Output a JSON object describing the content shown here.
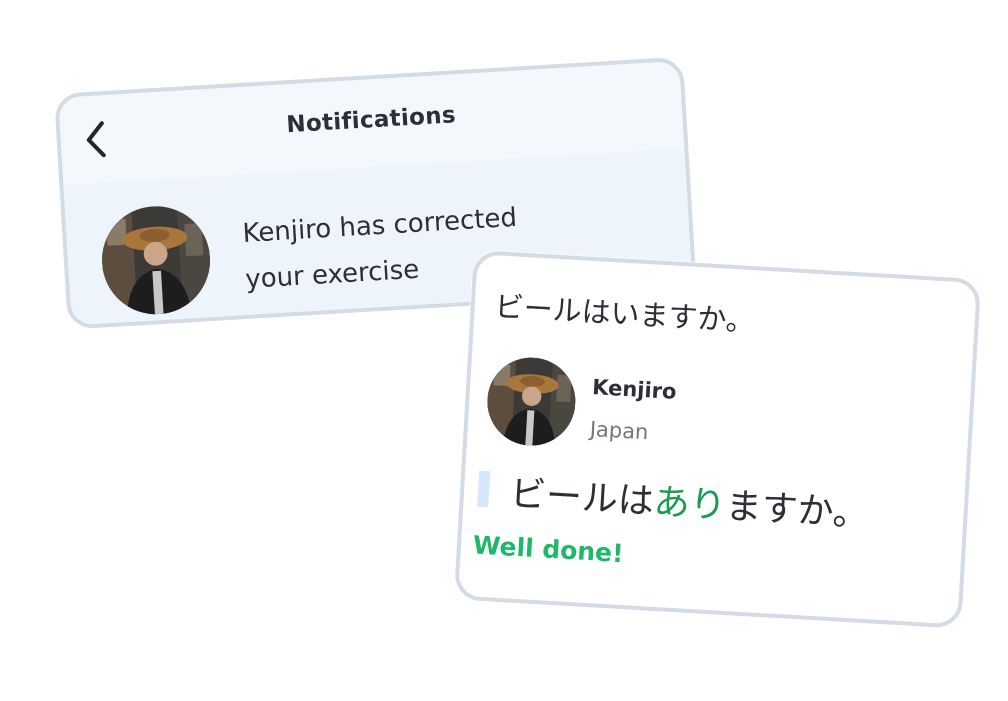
{
  "notification_card": {
    "title": "Notifications",
    "back_icon": "chevron-left-icon",
    "message_line1": "Kenjiro has corrected",
    "message_line2": "your exercise"
  },
  "correction_card": {
    "original_sentence": "ビールはいますか。",
    "user": {
      "name": "Kenjiro",
      "country": "Japan"
    },
    "corrected": {
      "prefix": "ビールは",
      "highlight": "あり",
      "suffix": "ますか。"
    },
    "feedback": "Well done!"
  },
  "colors": {
    "card_border": "#d3dce5",
    "correction_highlight": "#1a9a52",
    "feedback_green": "#1fb869",
    "quote_bar": "#d5e8fb"
  }
}
